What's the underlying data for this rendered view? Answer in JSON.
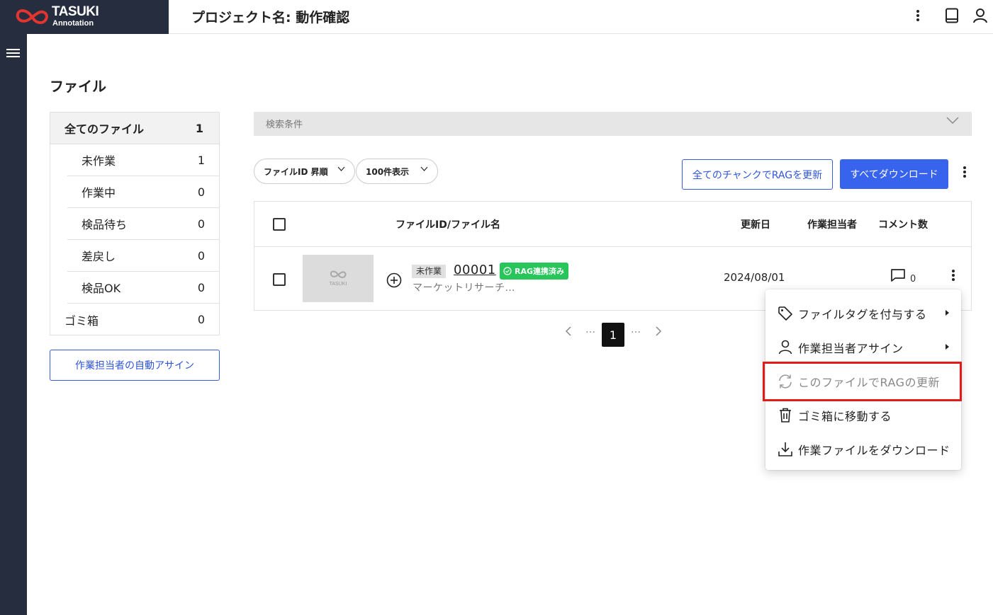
{
  "app": {
    "brand_main": "TASUKI",
    "brand_sub": "Annotation"
  },
  "header": {
    "project_title": "プロジェクト名: 動作確認"
  },
  "page": {
    "heading": "ファイル"
  },
  "status_panel": {
    "all": {
      "label": "全てのファイル",
      "count": "1"
    },
    "items": [
      {
        "label": "未作業",
        "count": "1"
      },
      {
        "label": "作業中",
        "count": "0"
      },
      {
        "label": "検品待ち",
        "count": "0"
      },
      {
        "label": "差戻し",
        "count": "0"
      },
      {
        "label": "検品OK",
        "count": "0"
      }
    ],
    "trash": {
      "label": "ゴミ箱",
      "count": "0"
    }
  },
  "auto_assign_label": "作業担当者の自動アサイン",
  "search": {
    "label": "検索条件"
  },
  "toolbar": {
    "sort_label": "ファイルID 昇順",
    "per_page_label": "100件表示",
    "rag_update_all_label": "全てのチャンクでRAGを更新",
    "download_all_label": "すべてダウンロード"
  },
  "table": {
    "columns": {
      "file": "ファイルID/ファイル名",
      "updated": "更新日",
      "assignee": "作業担当者",
      "comments": "コメント数"
    },
    "rows": [
      {
        "thumb_text": "TASUKI",
        "status": "未作業",
        "file_id": "00001",
        "rag_badge": "RAG連携済み",
        "file_name": "マーケットリサーチ…",
        "updated": "2024/08/01",
        "assignee": "",
        "comments": "0"
      }
    ]
  },
  "pagination": {
    "current": "1",
    "ellipsis": "…"
  },
  "context_menu": {
    "items": [
      {
        "label": "ファイルタグを付与する",
        "icon": "tag-icon",
        "submenu": true
      },
      {
        "label": "作業担当者アサイン",
        "icon": "person-icon",
        "submenu": true
      },
      {
        "label": "このファイルでRAGの更新",
        "icon": "refresh-icon",
        "disabled": true
      },
      {
        "label": "ゴミ箱に移動する",
        "icon": "trash-icon"
      },
      {
        "label": "作業ファイルをダウンロード",
        "icon": "download-icon"
      }
    ]
  },
  "colors": {
    "sidebar": "#252d3f",
    "primary": "#3863ec",
    "rag_badge": "#27c55a",
    "highlight": "#e21a1a"
  }
}
